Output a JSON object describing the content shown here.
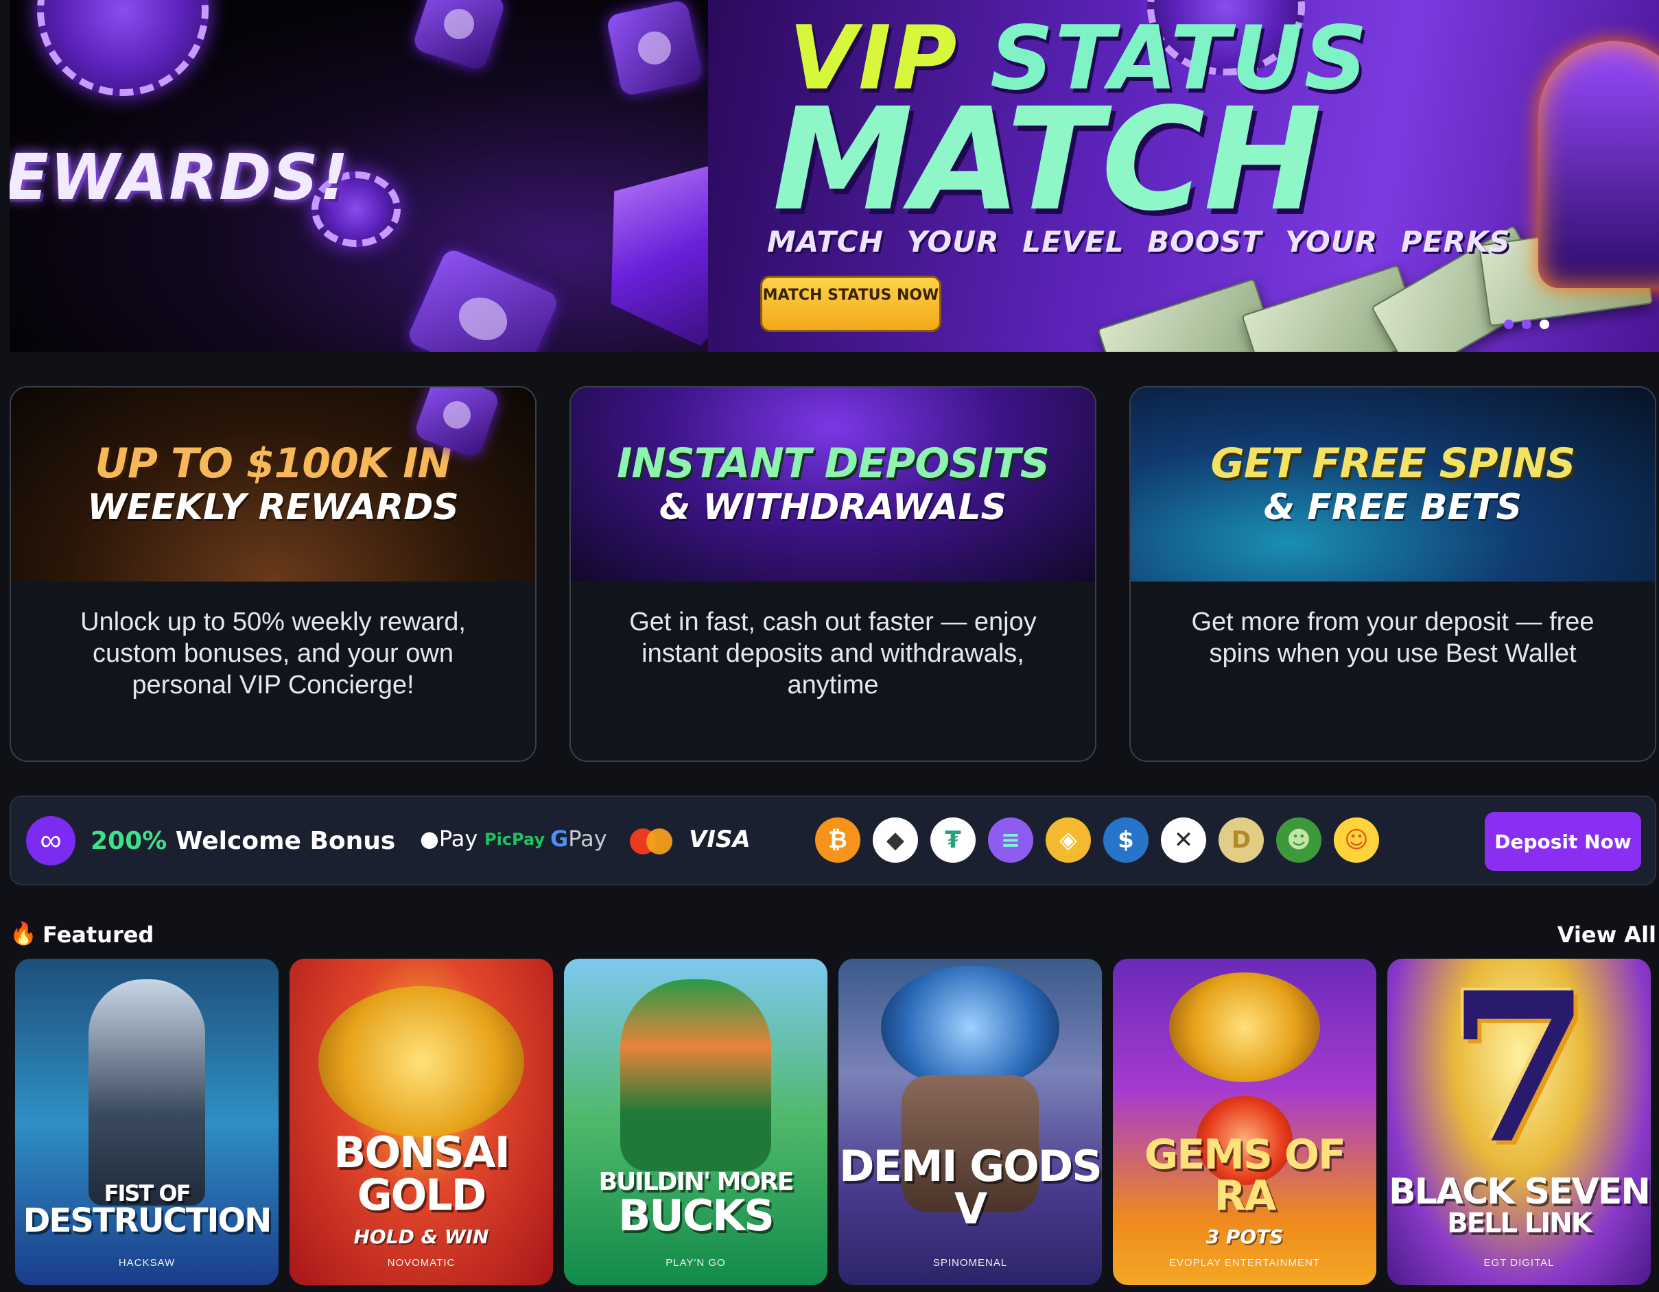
{
  "hero": {
    "left_text": "EWARDS!",
    "title_line1_a": "VIP",
    "title_line1_b": "STATUS",
    "title_line2": "MATCH",
    "subtitle": "MATCH YOUR LEVEL  BOOST YOUR PERKS",
    "cta_label": "MATCH STATUS NOW",
    "slides": 3,
    "active_slide": 3
  },
  "cards": [
    {
      "title1": "UP TO $100K IN",
      "title2": "WEEKLY REWARDS",
      "description": "Unlock up to 50% weekly reward, custom bonuses, and your own personal VIP Concierge!"
    },
    {
      "title1": "INSTANT DEPOSITS",
      "title2": "& WITHDRAWALS",
      "description": "Get in fast, cash out faster — enjoy instant deposits and withdrawals, anytime"
    },
    {
      "title1": "GET FREE SPINS",
      "title2": "& FREE BETS",
      "description": "Get more from your deposit — free spins when you use Best Wallet"
    }
  ],
  "strip": {
    "bonus_pct": "200%",
    "bonus_text": "Welcome Bonus",
    "apple_pay": "Pay",
    "picpay": "PicPay",
    "gpay_g": "G",
    "gpay": "Pay",
    "visa": "VISA",
    "deposit_label": "Deposit Now",
    "coins": [
      {
        "name": "bitcoin-icon",
        "glyph": "₿",
        "bg": "#f7931a",
        "fg": "#ffffff"
      },
      {
        "name": "ethereum-icon",
        "glyph": "◆",
        "bg": "#ffffff",
        "fg": "#343434"
      },
      {
        "name": "tether-icon",
        "glyph": "₮",
        "bg": "#ffffff",
        "fg": "#26a17b"
      },
      {
        "name": "solana-icon",
        "glyph": "≡",
        "bg": "#8e5cf0",
        "fg": "#7ef5d0"
      },
      {
        "name": "bnb-icon",
        "glyph": "◈",
        "bg": "#f3ba2f",
        "fg": "#ffffff"
      },
      {
        "name": "usdc-icon",
        "glyph": "$",
        "bg": "#2775ca",
        "fg": "#ffffff"
      },
      {
        "name": "xrp-icon",
        "glyph": "✕",
        "bg": "#ffffff",
        "fg": "#23292f"
      },
      {
        "name": "dogecoin-icon",
        "glyph": "D",
        "bg": "#e1cd86",
        "fg": "#b08a2a"
      },
      {
        "name": "pepe-icon",
        "glyph": "☻",
        "bg": "#3d9a3a",
        "fg": "#c1e6a8"
      },
      {
        "name": "shiba-icon",
        "glyph": "☺",
        "bg": "#ffd43a",
        "fg": "#e2551a"
      }
    ]
  },
  "featured": {
    "title": "Featured",
    "view_all": "View All",
    "games": [
      {
        "title": "FIST OF",
        "title2": "DESTRUCTION",
        "sub": "",
        "provider": "HACKSAW"
      },
      {
        "title": "BONSAI GOLD",
        "title2": "",
        "sub": "HOLD & WIN",
        "provider": "NOVOMATIC"
      },
      {
        "title": "BUILDIN' MORE",
        "title2": "BUCKS",
        "sub": "",
        "provider": "PLAY'N GO"
      },
      {
        "title": "DEMI GODS V",
        "title2": "",
        "sub": "",
        "provider": "SPINOMENAL"
      },
      {
        "title": "GEMS OF RA",
        "title2": "",
        "sub": "3 POTS",
        "provider": "EVOPLAY ENTERTAINMENT"
      },
      {
        "title": "BLACK SEVEN",
        "title2": "BELL LINK",
        "sub": "",
        "provider": "EGT DIGITAL"
      }
    ]
  }
}
